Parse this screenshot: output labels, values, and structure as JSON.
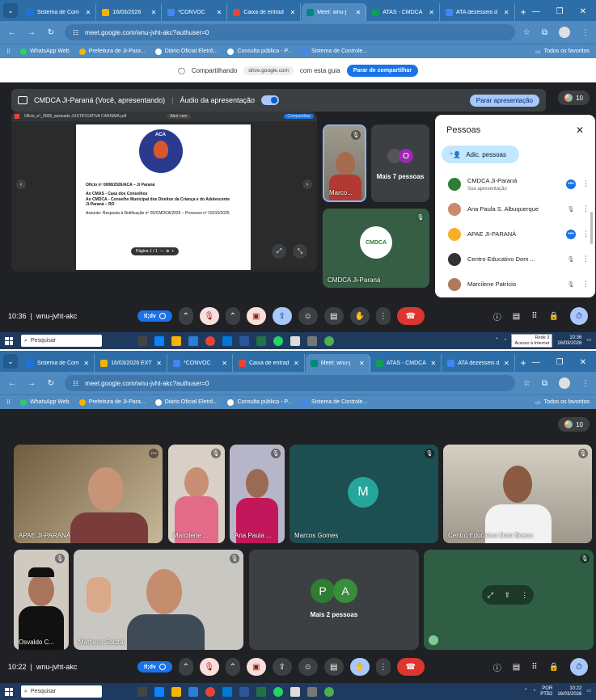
{
  "browser": {
    "tabs": [
      {
        "title": "Sistema de Com",
        "color": "#1a73e8"
      },
      {
        "title": "16/03/2026",
        "color": "#f4b400"
      },
      {
        "title": "*CONVOC",
        "color": "#4285f4"
      },
      {
        "title": "Caixa de entrad",
        "color": "#ea4335"
      },
      {
        "title": "Meet: wnu-j",
        "color": "#00897b"
      },
      {
        "title": "ATAS - CMDCA",
        "color": "#0f9d58"
      },
      {
        "title": "ATA dezesseis d",
        "color": "#4285f4"
      }
    ],
    "tabs2": [
      {
        "title": "Sistema de Com",
        "color": "#1a73e8"
      },
      {
        "title": "16/03/2026 EXT",
        "color": "#f4b400"
      },
      {
        "title": "*CONVOC",
        "color": "#4285f4"
      },
      {
        "title": "Caixa de entrad",
        "color": "#ea4335"
      },
      {
        "title": "Meet: wnu-j",
        "color": "#00897b"
      },
      {
        "title": "ATAS - CMDCA",
        "color": "#0f9d58"
      },
      {
        "title": "ATA dezesseis d",
        "color": "#4285f4"
      }
    ],
    "url": "meet.google.com/wnu-jvht-akc?authuser=0",
    "bookmarks": [
      "WhatsApp Web",
      "Prefeitura de Ji-Para...",
      "Diário Oficial Eletrô...",
      "Consulta pública - P...",
      "Sistema de Controle..."
    ],
    "all_bookmarks": "Todos os favoritos"
  },
  "share_banner": {
    "text_before": "Compartilhando",
    "domain": "drive.google.com",
    "text_after": "com esta guia",
    "stop_button": "Parar de compartilhar"
  },
  "meeting": {
    "code": "wnu-jvht-akc",
    "presenting_label": "CMDCA Ji-Paraná (Você, apresentando)",
    "audio_label": "Áudio da apresentação",
    "stop_presenting": "Parar apresentação",
    "participant_count": "10",
    "tldv_label": "tl;dv",
    "time1": "10:36",
    "time2": "10:22"
  },
  "shared_doc": {
    "filename": "Oficio_nº_0008_assinado JUSTIFICATIVA CARISMA.pdf",
    "share_btn": "Compartilhar",
    "edit_btn": "Abrir com",
    "logo_text": "ACA",
    "line1": "Ofício nº 0008/2026/ACA – Ji Paraná",
    "line2": "Ao CMAS - Casa dos Conselhos",
    "line3": "Ao CMDCA - Conselho Municipal dos Direitos da Criança e do Adolescente",
    "line4": "Ji-Paraná – RO",
    "line5": "Assunto: Resposta à Notificação nº 05/CMDCA/2026 – Processo nº 15015/2025",
    "page_label": "Página",
    "page_num": "1",
    "page_total": "1"
  },
  "tiles1": {
    "marco": "Marco...",
    "more": "Mais 7 pessoas",
    "more_initial": "O",
    "cmdca": "CMDCA Ji-Paraná",
    "cmdca_logo": "CMDCA"
  },
  "people": {
    "title": "Pessoas",
    "add": "Adic. pessoas",
    "list": [
      {
        "name": "CMDCA Ji-Paraná",
        "sub": "Sua apresentação",
        "color": "#2e7d32"
      },
      {
        "name": "Ana Paula S. Albuquerque",
        "sub": "",
        "color": "#c98b6b"
      },
      {
        "name": "APAE JI-PARANÁ",
        "sub": "",
        "color": "#f6b026"
      },
      {
        "name": "Centro Educativo Dom ...",
        "sub": "",
        "color": "#333333"
      },
      {
        "name": "Marcilene Patrício",
        "sub": "",
        "color": "#b07a5a"
      }
    ]
  },
  "grid2": {
    "apae": "APAE JI-PARANÁ",
    "marcilene": "Marcilene ...",
    "anapaula": "Ana Paula ...",
    "marcos": "Marcos Gomes",
    "marcos_initial": "M",
    "centro": "Centro Educativo Dom Bosco",
    "osvaldo": "Osvaldo C...",
    "matheus": "Matheus Souza",
    "more": "Mais 2 pessoas",
    "more_p": "P",
    "more_a": "A"
  },
  "taskbar": {
    "search": "Pesquisar",
    "lang": "POR",
    "layout": "PTB2",
    "time1": "10:36",
    "date1": "16/03/2026",
    "time2": "10:22",
    "date2": "16/03/2026",
    "net_tip1": "Rede 3",
    "net_tip2": "Acesso à Internet"
  }
}
